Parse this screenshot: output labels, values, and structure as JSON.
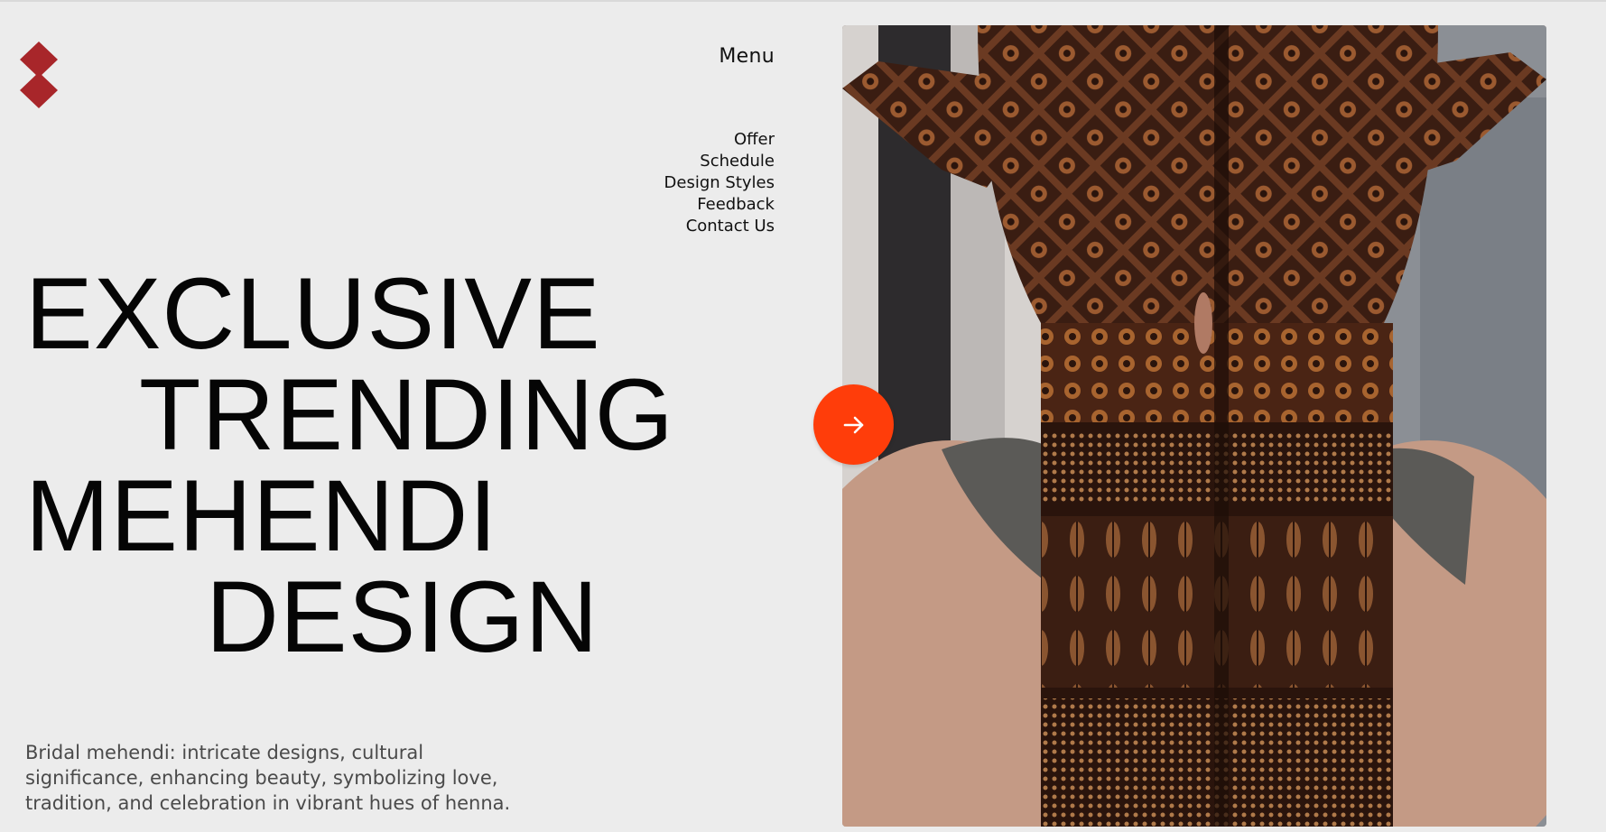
{
  "brand": {
    "logo_icon": "red-diamond-logo-icon",
    "color": "#a8262a"
  },
  "header": {
    "menu_label": "Menu"
  },
  "nav": {
    "items": [
      {
        "label": "Offer"
      },
      {
        "label": "Schedule"
      },
      {
        "label": "Design Styles"
      },
      {
        "label": "Feedback"
      },
      {
        "label": "Contact Us"
      }
    ]
  },
  "hero": {
    "line1": "EXCLUSIVE",
    "line2": "TRENDING",
    "line3": "MEHENDI",
    "line4": "DESIGN",
    "description": "Bridal mehendi: intricate designs, cultural significance, enhancing beauty, symbolizing love, tradition, and celebration in vibrant hues of henna."
  },
  "image": {
    "subject": "bridal mehendi henna hands photo"
  },
  "next_button": {
    "icon": "arrow-right-icon",
    "color": "#ff3d0a"
  }
}
